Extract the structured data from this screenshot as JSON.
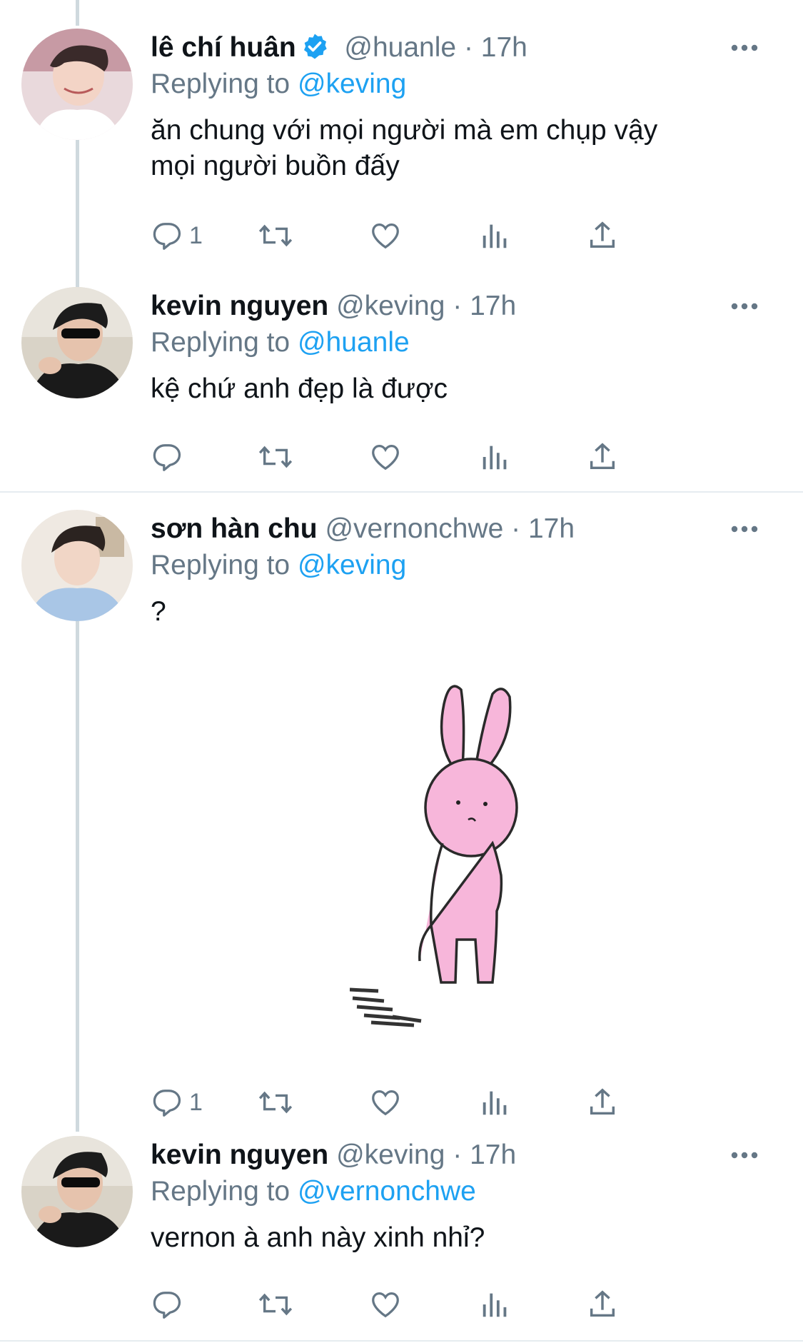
{
  "tweets": [
    {
      "name": "lê chí huân",
      "verified": true,
      "handle": "@huanle",
      "time": "· 17h",
      "replying_prefix": "Replying to",
      "replying_to": "@keving",
      "text_lines": [
        "ăn chung với mọi người mà em chụp vậy",
        "mọi người buồn đấy"
      ],
      "reply_count": "1",
      "avatar_icon": "avatar-photo"
    },
    {
      "name": "kevin nguyen",
      "verified": false,
      "handle": "@keving",
      "time": "· 17h",
      "replying_prefix": "Replying to",
      "replying_to": "@huanle",
      "text_lines": [
        "kệ chứ anh đẹp là được"
      ],
      "reply_count": "",
      "avatar_icon": "avatar-photo"
    },
    {
      "name": "sơn hàn chu",
      "verified": false,
      "handle": "@vernonchwe",
      "time": "· 17h",
      "replying_prefix": "Replying to",
      "replying_to": "@keving",
      "text_lines": [
        "?"
      ],
      "reply_count": "1",
      "avatar_icon": "avatar-photo",
      "media": "pink-bunny-sticker"
    },
    {
      "name": "kevin nguyen",
      "verified": false,
      "handle": "@keving",
      "time": "· 17h",
      "replying_prefix": "Replying to",
      "replying_to": "@vernonchwe",
      "text_lines": [
        "vernon à anh này xinh nhỉ?"
      ],
      "reply_count": "",
      "avatar_icon": "avatar-photo"
    }
  ],
  "colors": {
    "text": "#0f1419",
    "secondary": "#657786",
    "accent": "#1da1f2",
    "divider": "#e6ecf0",
    "thread": "#cfd9de",
    "bunny": "#f7b6da"
  },
  "icons": {
    "more": "more-dots-icon",
    "reply": "reply-icon",
    "retweet": "retweet-icon",
    "like": "like-icon",
    "analytics": "analytics-icon",
    "share": "share-icon",
    "verified": "verified-badge-icon"
  }
}
